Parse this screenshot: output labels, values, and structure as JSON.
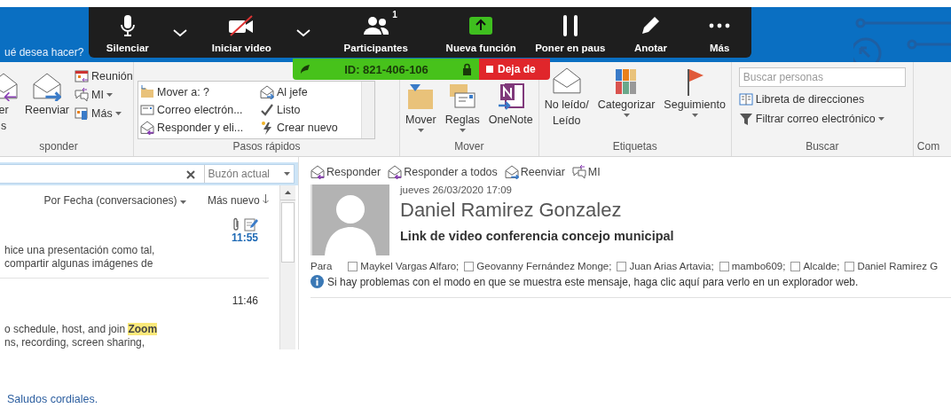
{
  "tell_me": "ué desea hacer?",
  "zoom_toolbar": {
    "items": [
      {
        "kind": "mic",
        "label": "Silenciar"
      },
      {
        "kind": "caret"
      },
      {
        "kind": "video_off",
        "label": "Iniciar video"
      },
      {
        "kind": "caret"
      },
      {
        "kind": "participants",
        "label": "Participantes",
        "count": "1"
      },
      {
        "kind": "share",
        "label": "Nueva función"
      },
      {
        "kind": "pause",
        "label": "Poner en paus"
      },
      {
        "kind": "annotate",
        "label": "Anotar"
      },
      {
        "kind": "more",
        "label": "Más"
      }
    ]
  },
  "meeting_bar": {
    "id": "ID: 821-406-106",
    "stop_label": "Deja de"
  },
  "ribbon": {
    "groups": [
      {
        "kind": "respond",
        "label": "sponder",
        "big": [
          {
            "kind": "reply_all",
            "lines": [
              "er",
              "s"
            ]
          },
          {
            "kind": "forward",
            "lines": [
              "Reenviar"
            ]
          }
        ],
        "small": [
          {
            "kind": "meeting",
            "label": "Reunión",
            "dropdown": false
          },
          {
            "kind": "im",
            "label": "MI",
            "dropdown": true
          },
          {
            "kind": "more",
            "label": "Más",
            "dropdown": true
          }
        ]
      },
      {
        "kind": "quick_steps",
        "label": "Pasos rápidos",
        "items": [
          {
            "kind": "folder",
            "label": "Mover a: ?"
          },
          {
            "kind": "boss",
            "label": "Al jefe"
          },
          {
            "kind": "mail",
            "label": "Correo electrón..."
          },
          {
            "kind": "done",
            "label": "Listo"
          },
          {
            "kind": "reply_delete",
            "label": "Responder y eli..."
          },
          {
            "kind": "new",
            "label": "Crear nuevo"
          }
        ]
      },
      {
        "kind": "buttons",
        "label": "Mover",
        "items": [
          {
            "kind": "move",
            "lines": [
              "Mover"
            ],
            "dropdown": true
          },
          {
            "kind": "rules",
            "lines": [
              "Reglas"
            ],
            "dropdown": true
          },
          {
            "kind": "onenote",
            "lines": [
              "OneNote"
            ],
            "dropdown": false
          }
        ]
      },
      {
        "kind": "buttons",
        "label": "Etiquetas",
        "items": [
          {
            "kind": "unread",
            "lines": [
              "No leído/",
              "Leído"
            ],
            "dropdown": false
          },
          {
            "kind": "categorize",
            "lines": [
              "Categorizar"
            ],
            "dropdown": true
          },
          {
            "kind": "flag",
            "lines": [
              "Seguimiento"
            ],
            "dropdown": true
          }
        ]
      },
      {
        "kind": "find",
        "label": "Buscar",
        "search_placeholder": "Buscar personas",
        "items": [
          {
            "kind": "address_book",
            "label": "Libreta de direcciones",
            "dropdown": false
          },
          {
            "kind": "filter",
            "label": "Filtrar correo electrónico",
            "dropdown": true
          }
        ]
      },
      {
        "kind": "cut",
        "label": "Com"
      }
    ]
  },
  "mail_list": {
    "scope": "Buzón actual",
    "sort": "Por Fecha (conversaciones)",
    "order": "Más nuevo",
    "messages": [
      {
        "time": "11:55",
        "unread": true,
        "attachment": true,
        "draft": true,
        "preview": [
          [
            {
              "text": "hice una presentación como tal,",
              "highlighted": false
            }
          ],
          [
            {
              "text": "compartir algunas imágenes de",
              "highlighted": false
            }
          ]
        ]
      },
      {
        "time": "11:46",
        "unread": false,
        "attachment": false,
        "draft": false,
        "preview": [
          [
            {
              "text": "o schedule, host, and join ",
              "highlighted": false
            },
            {
              "text": "Zoom",
              "highlighted": true
            }
          ],
          [
            {
              "text": "ns, recording, screen sharing,",
              "highlighted": false
            }
          ]
        ]
      }
    ]
  },
  "reading_pane": {
    "actions": [
      {
        "kind": "reply",
        "label": "Responder"
      },
      {
        "kind": "reply_all",
        "label": "Responder a todos"
      },
      {
        "kind": "forward",
        "label": "Reenviar"
      },
      {
        "kind": "im",
        "label": "MI"
      }
    ],
    "date": "jueves 26/03/2020 17:09",
    "sender": "Daniel Ramirez Gonzalez",
    "subject": "Link de video conferencia concejo municipal",
    "to_label": "Para",
    "recipients": [
      "Maykel Vargas Alfaro;",
      "Geovanny Fernández Monge;",
      "Juan Arias Artavia;",
      "mambo609;",
      "Alcalde;",
      "Daniel Ramirez G"
    ],
    "info": "Si hay problemas con el modo en que se muestra este mensaje, haga clic aquí para verlo en un explorador web."
  },
  "body_text": "Saludos cordiales."
}
